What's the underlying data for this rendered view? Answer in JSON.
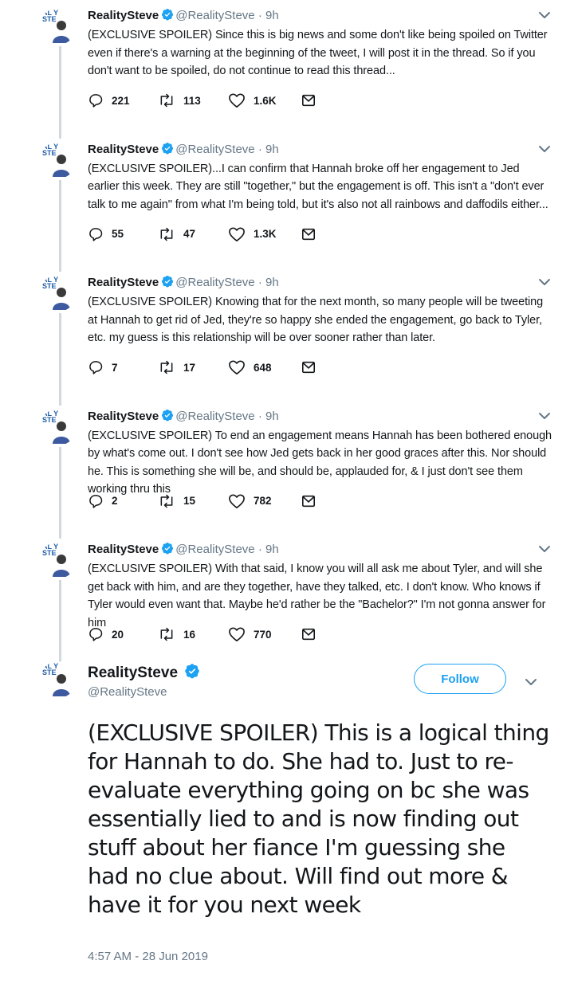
{
  "thread": [
    {
      "name": "RealitySteve",
      "handle": "@RealitySteve",
      "time": "9h",
      "text": "(EXCLUSIVE SPOILER) Since this is big news and some don't like being spoiled on Twitter even if there's a warning at the beginning of the tweet, I will post it in the thread.  So if you don't want to be spoiled, do not continue to read this thread...",
      "replies": "221",
      "retweets": "113",
      "likes": "1.6K"
    },
    {
      "name": "RealitySteve",
      "handle": "@RealitySteve",
      "time": "9h",
      "text": "(EXCLUSIVE SPOILER)...I can confirm that Hannah broke off her engagement to Jed earlier this week.  They are still \"together,\" but the engagement is off.  This isn't a \"don't ever talk to me again\" from what I'm being told, but it's also not all rainbows and daffodils either...",
      "replies": "55",
      "retweets": "47",
      "likes": "1.3K"
    },
    {
      "name": "RealitySteve",
      "handle": "@RealitySteve",
      "time": "9h",
      "text": "(EXCLUSIVE SPOILER) Knowing that for the next month, so many people will be tweeting at Hannah to get rid of Jed, they're so happy she ended the engagement, go back to Tyler, etc. my guess is this relationship will be over sooner rather than later.",
      "replies": "7",
      "retweets": "17",
      "likes": "648"
    },
    {
      "name": "RealitySteve",
      "handle": "@RealitySteve",
      "time": "9h",
      "text": "(EXCLUSIVE SPOILER) To end an engagement means Hannah has been bothered enough by what's come out.  I don't see how Jed gets back in her good graces after this. Nor should he.  This is something she will be, and should be, applauded for, & I just don't see them working thru this",
      "replies": "2",
      "retweets": "15",
      "likes": "782"
    },
    {
      "name": "RealitySteve",
      "handle": "@RealitySteve",
      "time": "9h",
      "text": "(EXCLUSIVE SPOILER) With that said, I know you will all ask me about Tyler, and will she get back with him, and are they together, have they talked, etc.  I don't know. Who knows if Tyler would even want that.  Maybe he'd rather be the \"Bachelor?\" I'm not gonna answer for him",
      "replies": "20",
      "retweets": "16",
      "likes": "770"
    }
  ],
  "main": {
    "name": "RealitySteve",
    "handle": "@RealitySteve",
    "follow_label": "Follow",
    "text": "(EXCLUSIVE SPOILER) This is a logical thing for Hannah to do.  She had to.  Just to re-evaluate everything going on bc she was essentially lied to and is now finding out stuff about her fiance I'm guessing she had no clue about.  Will find out more & have it for you next week",
    "timestamp": "4:57 AM - 28 Jun 2019"
  },
  "avatar_logo": "ALITY STE",
  "colors": {
    "accent": "#1da1f2",
    "secondary_text": "#657786",
    "thread_line": "#cfd9de"
  },
  "icons": [
    "reply-icon",
    "retweet-icon",
    "like-icon",
    "dm-icon",
    "verified-icon",
    "chevron-down-icon"
  ]
}
